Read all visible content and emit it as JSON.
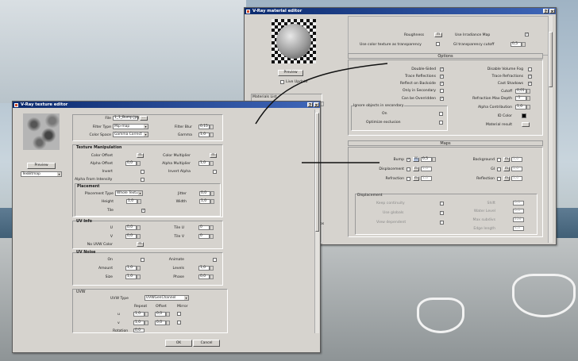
{
  "material_editor": {
    "title": "V-Ray material editor",
    "preview_button": "Preview",
    "live_update": "Live Update",
    "materials_list": "Materials List",
    "roughness": "Roughness",
    "use_irradiance_map": "Use Irradiance Map",
    "use_color_texture": "Use color texture as transparency",
    "gi_transparency_cutoff": "GI transparency cutoff",
    "gi_cutoff_value": "0,5",
    "options_header": "Options",
    "options_left": [
      {
        "label": "Double-Sided",
        "checked": true
      },
      {
        "label": "Trace Reflections",
        "checked": true
      },
      {
        "label": "Reflect on Backside",
        "checked": true
      },
      {
        "label": "Only in Secondary",
        "checked": false
      },
      {
        "label": "Can be Overridden",
        "checked": true
      }
    ],
    "options_right": [
      {
        "label": "Disable Volume Fog",
        "checked": false
      },
      {
        "label": "Trace Refractions",
        "checked": true
      },
      {
        "label": "Cast Shadows",
        "checked": true
      }
    ],
    "cutoff_label": "Cutoff",
    "cutoff_value": "0,01",
    "refraction_max_depth": "Refraction Max Depth",
    "refraction_max_depth_value": "-1",
    "alpha_contribution": "Alpha Contribution",
    "alpha_contribution_value": "1,0",
    "id_color": "ID Color",
    "material_result": "Material result",
    "ignore_header": "Ignore objects in secondary",
    "ignore_on": "On",
    "optimize_exclusion": "Optimize exclusion",
    "maps_header": "Maps",
    "maps": [
      {
        "label": "Bump",
        "value": "0,5",
        "m": "M"
      },
      {
        "label": "Displacement",
        "value": "1,0",
        "m": "m"
      },
      {
        "label": "Refraction",
        "value": "1,0",
        "m": "m"
      }
    ],
    "maps_right": [
      {
        "label": "Background",
        "value": "1,0",
        "m": "m"
      },
      {
        "label": "GI",
        "value": "1,0",
        "m": "m"
      },
      {
        "label": "Reflection",
        "value": "1,0",
        "m": "m"
      }
    ],
    "displacement_header": "Displacement",
    "disp_left": [
      "Keep continuity",
      "Use globals",
      "View dependent"
    ],
    "disp_right": [
      {
        "label": "Shift",
        "value": "0,0"
      },
      {
        "label": "Water Level",
        "value": "0,0"
      },
      {
        "label": "Max subdivs",
        "value": "256"
      },
      {
        "label": "Edge length",
        "value": "4,0"
      }
    ],
    "list_item": "os"
  },
  "texture_editor": {
    "title": "V-Ray texture editor",
    "preview_button": "Preview",
    "texture_type": "TexBitmap",
    "file_label": "File",
    "file_value": "1_1_Bump.jpg",
    "browse": "...",
    "filter_type_label": "Filter Type",
    "filter_type_value": "Mip-map",
    "filter_blur_label": "Filter Blur",
    "filter_blur_value": "0,15",
    "color_space_label": "Color Space",
    "color_space_value": "Gamma Correct",
    "gamma_label": "Gamma",
    "gamma_value": "1,0",
    "manipulation_header": "Texture Manipulation",
    "color_offset": "Color Offset",
    "color_multiplier": "Color Multiplier",
    "alpha_offset": "Alpha Offset",
    "alpha_offset_value": "0,0",
    "alpha_multiplier": "Alpha Multiplier",
    "alpha_multiplier_value": "1,0",
    "invert": "Invert",
    "invert_alpha": "Invert Alpha",
    "alpha_from_intensity": "Alpha From Intensity",
    "placement_header": "Placement",
    "placement_type_label": "Placement Type",
    "placement_type_value": "Whole Texture",
    "jitter_label": "Jitter",
    "jitter_value": "0,0",
    "height_label": "Height",
    "height_value": "1,0",
    "width_label": "Width",
    "width_value": "1,0",
    "tile_label": "Tile",
    "uv_info_header": "UV Info",
    "u_label": "U",
    "u_value": "0,0",
    "v_label": "V",
    "v_value": "0,0",
    "tile_u_label": "Tile U",
    "tile_u_value": "0",
    "tile_v_label": "Tile V",
    "tile_v_value": "0",
    "no_uvw_color": "No UVW Color",
    "uv_noise_header": "UV Noise",
    "on_label": "On",
    "animate_label": "Animate",
    "amount_label": "Amount",
    "amount_value": "1,0",
    "levels_label": "Levels",
    "levels_value": "1,0",
    "size_label": "Size",
    "size_value": "1,0",
    "phase_label": "Phase",
    "phase_value": "0,0",
    "uvw_header": "UVW",
    "uvw_type_label": "UVW Type",
    "uvw_type_value": "UVWGenChannel",
    "repeat_label": "Repeat",
    "offset_label": "Offset",
    "mirror_label": "Mirror",
    "uvw_u": "u",
    "uvw_v": "v",
    "rotation_label": "Rotation",
    "repeat_u": "1,0",
    "offset_u": "0,0",
    "repeat_v": "1,0",
    "offset_v": "0,0",
    "rotation_value": "0,0",
    "ok": "OK",
    "cancel": "Cancel"
  },
  "m_label": "m"
}
